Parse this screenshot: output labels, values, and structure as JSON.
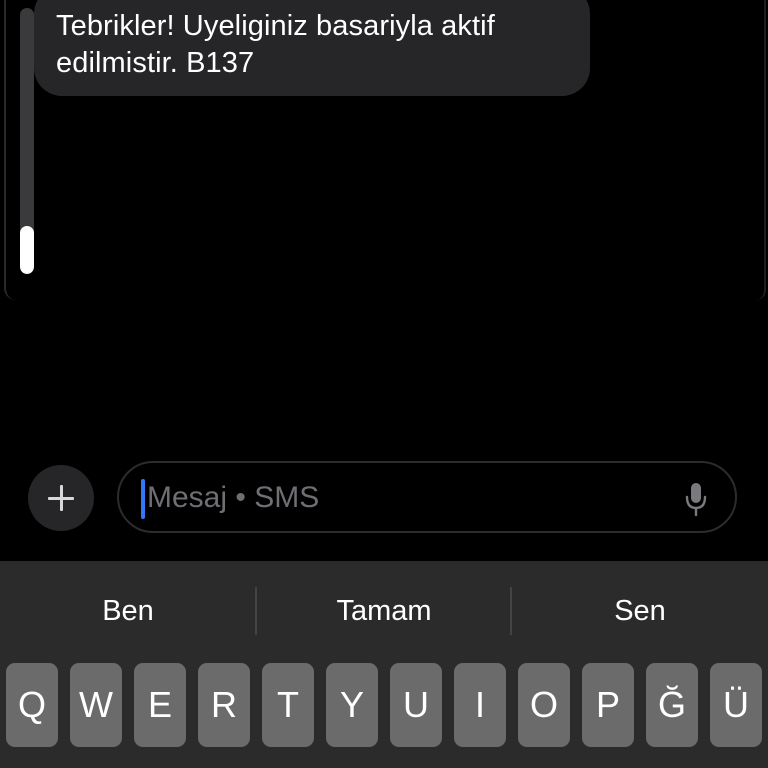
{
  "message": {
    "text_line1": "Tebrikler! Uyeliginiz basariyla aktif",
    "text_line2": "edilmistir. B137"
  },
  "composer": {
    "placeholder": "Mesaj • SMS",
    "plus_icon": "plus-icon",
    "mic_icon": "microphone-icon"
  },
  "scroll": {
    "position_fraction": 1.0
  },
  "keyboard": {
    "suggestions": [
      "Ben",
      "Tamam",
      "Sen"
    ],
    "keys": [
      "Q",
      "W",
      "E",
      "R",
      "T",
      "Y",
      "U",
      "I",
      "O",
      "P",
      "Ğ",
      "Ü"
    ]
  },
  "colors": {
    "background": "#000000",
    "bubble": "#262628",
    "caret": "#3478f6",
    "key": "#6b6b6b",
    "keyboard": "#2b2b2b"
  }
}
